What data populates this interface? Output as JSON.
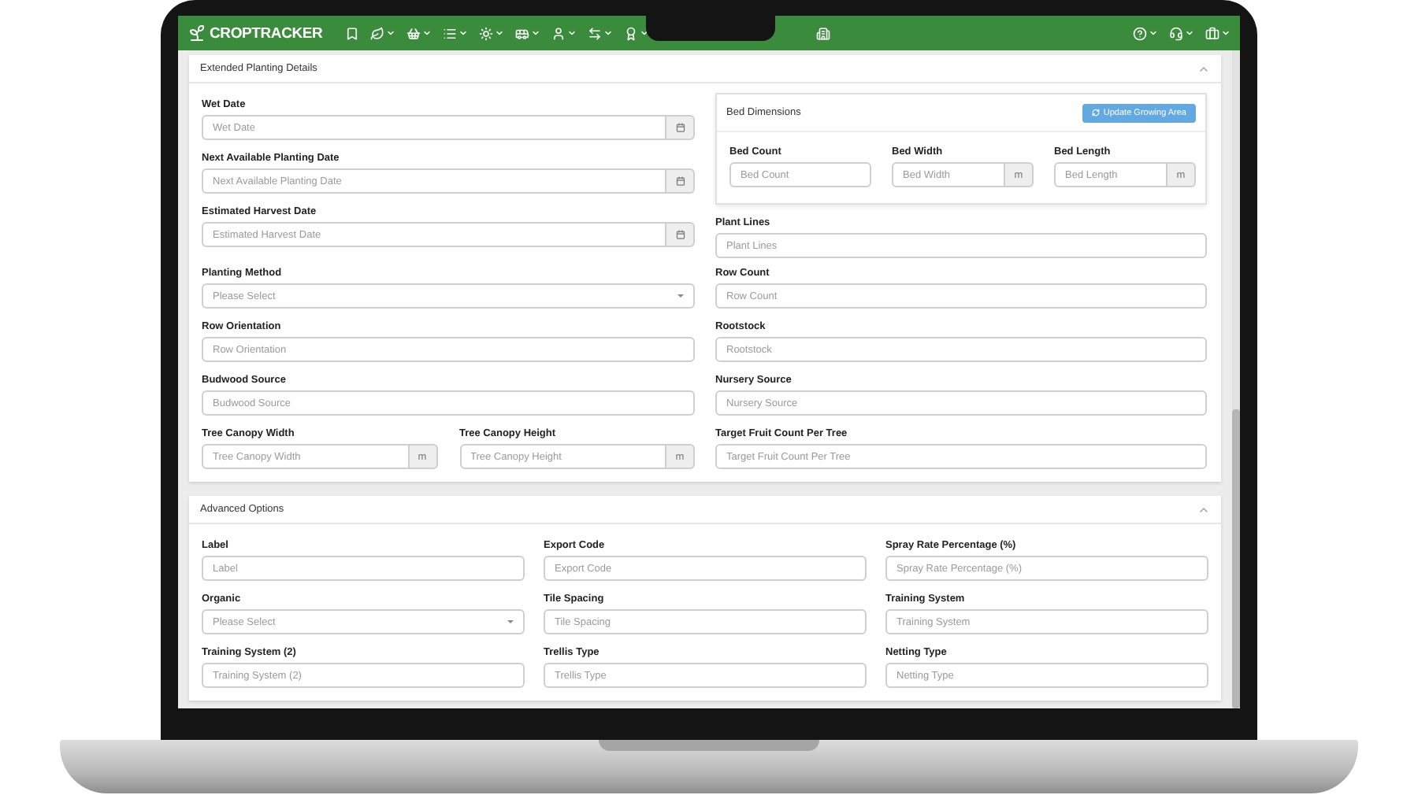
{
  "navbar": {
    "brand": "CROPTRACKER"
  },
  "extended": {
    "title": "Extended Planting Details",
    "expanded": true,
    "date_fields": [
      {
        "label": "Wet Date",
        "placeholder": "Wet Date"
      },
      {
        "label": "Next Available Planting Date",
        "placeholder": "Next Available Planting Date"
      },
      {
        "label": "Estimated Harvest Date",
        "placeholder": "Estimated Harvest Date"
      }
    ],
    "bed_dimensions": {
      "title": "Bed Dimensions",
      "button": "Update Growing Area",
      "fields": [
        {
          "label": "Bed Count",
          "placeholder": "Bed Count"
        },
        {
          "label": "Bed Width",
          "placeholder": "Bed Width",
          "unit": "m"
        },
        {
          "label": "Bed Length",
          "placeholder": "Bed Length",
          "unit": "m"
        }
      ]
    },
    "plant_lines": {
      "label": "Plant Lines",
      "placeholder": "Plant Lines"
    },
    "fields": [
      {
        "kind": "select",
        "label": "Planting Method",
        "placeholder": "Please Select"
      },
      {
        "kind": "text",
        "label": "Row Count",
        "placeholder": "Row Count"
      },
      {
        "kind": "text",
        "label": "Row Orientation",
        "placeholder": "Row Orientation"
      },
      {
        "kind": "text",
        "label": "Rootstock",
        "placeholder": "Rootstock"
      },
      {
        "kind": "text",
        "label": "Budwood Source",
        "placeholder": "Budwood Source"
      },
      {
        "kind": "text",
        "label": "Nursery Source",
        "placeholder": "Nursery Source"
      },
      {
        "kind": "pair",
        "fields": [
          {
            "label": "Tree Canopy Width",
            "placeholder": "Tree Canopy Width",
            "unit": "m"
          },
          {
            "label": "Tree Canopy Height",
            "placeholder": "Tree Canopy Height",
            "unit": "m"
          }
        ]
      },
      {
        "kind": "text",
        "label": "Target Fruit Count Per Tree",
        "placeholder": "Target Fruit Count Per Tree"
      }
    ]
  },
  "advanced": {
    "title": "Advanced Options",
    "expanded": true,
    "fields": [
      {
        "kind": "text",
        "label": "Label",
        "placeholder": "Label"
      },
      {
        "kind": "text",
        "label": "Export Code",
        "placeholder": "Export Code"
      },
      {
        "kind": "text",
        "label": "Spray Rate Percentage (%)",
        "placeholder": "Spray Rate Percentage (%)"
      },
      {
        "kind": "select",
        "label": "Organic",
        "placeholder": "Please Select"
      },
      {
        "kind": "text",
        "label": "Tile Spacing",
        "placeholder": "Tile Spacing"
      },
      {
        "kind": "text",
        "label": "Training System",
        "placeholder": "Training System"
      },
      {
        "kind": "text",
        "label": "Training System (2)",
        "placeholder": "Training System (2)"
      },
      {
        "kind": "text",
        "label": "Trellis Type",
        "placeholder": "Trellis Type"
      },
      {
        "kind": "text",
        "label": "Netting Type",
        "placeholder": "Netting Type"
      }
    ]
  }
}
